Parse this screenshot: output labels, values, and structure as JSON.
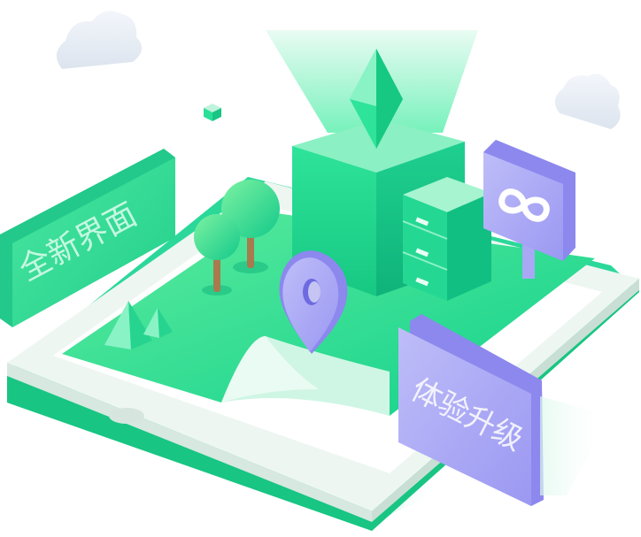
{
  "illustration": {
    "sign_left": {
      "text": "全新界面"
    },
    "sign_right": {
      "text": "体验升级"
    }
  },
  "icons": [
    "cloud-icon",
    "crystal-icon",
    "tree-icon",
    "location-pin-icon",
    "infinity-icon",
    "server-cabinet-icon",
    "pyramid-icon",
    "smartphone-icon",
    "cube-icon"
  ],
  "colors": {
    "primary_green": "#22D98E",
    "mint": "#BFF3DD",
    "lavender": "#A9A8F5",
    "purple": "#8C88EE",
    "device_white": "#EEF6F2"
  }
}
